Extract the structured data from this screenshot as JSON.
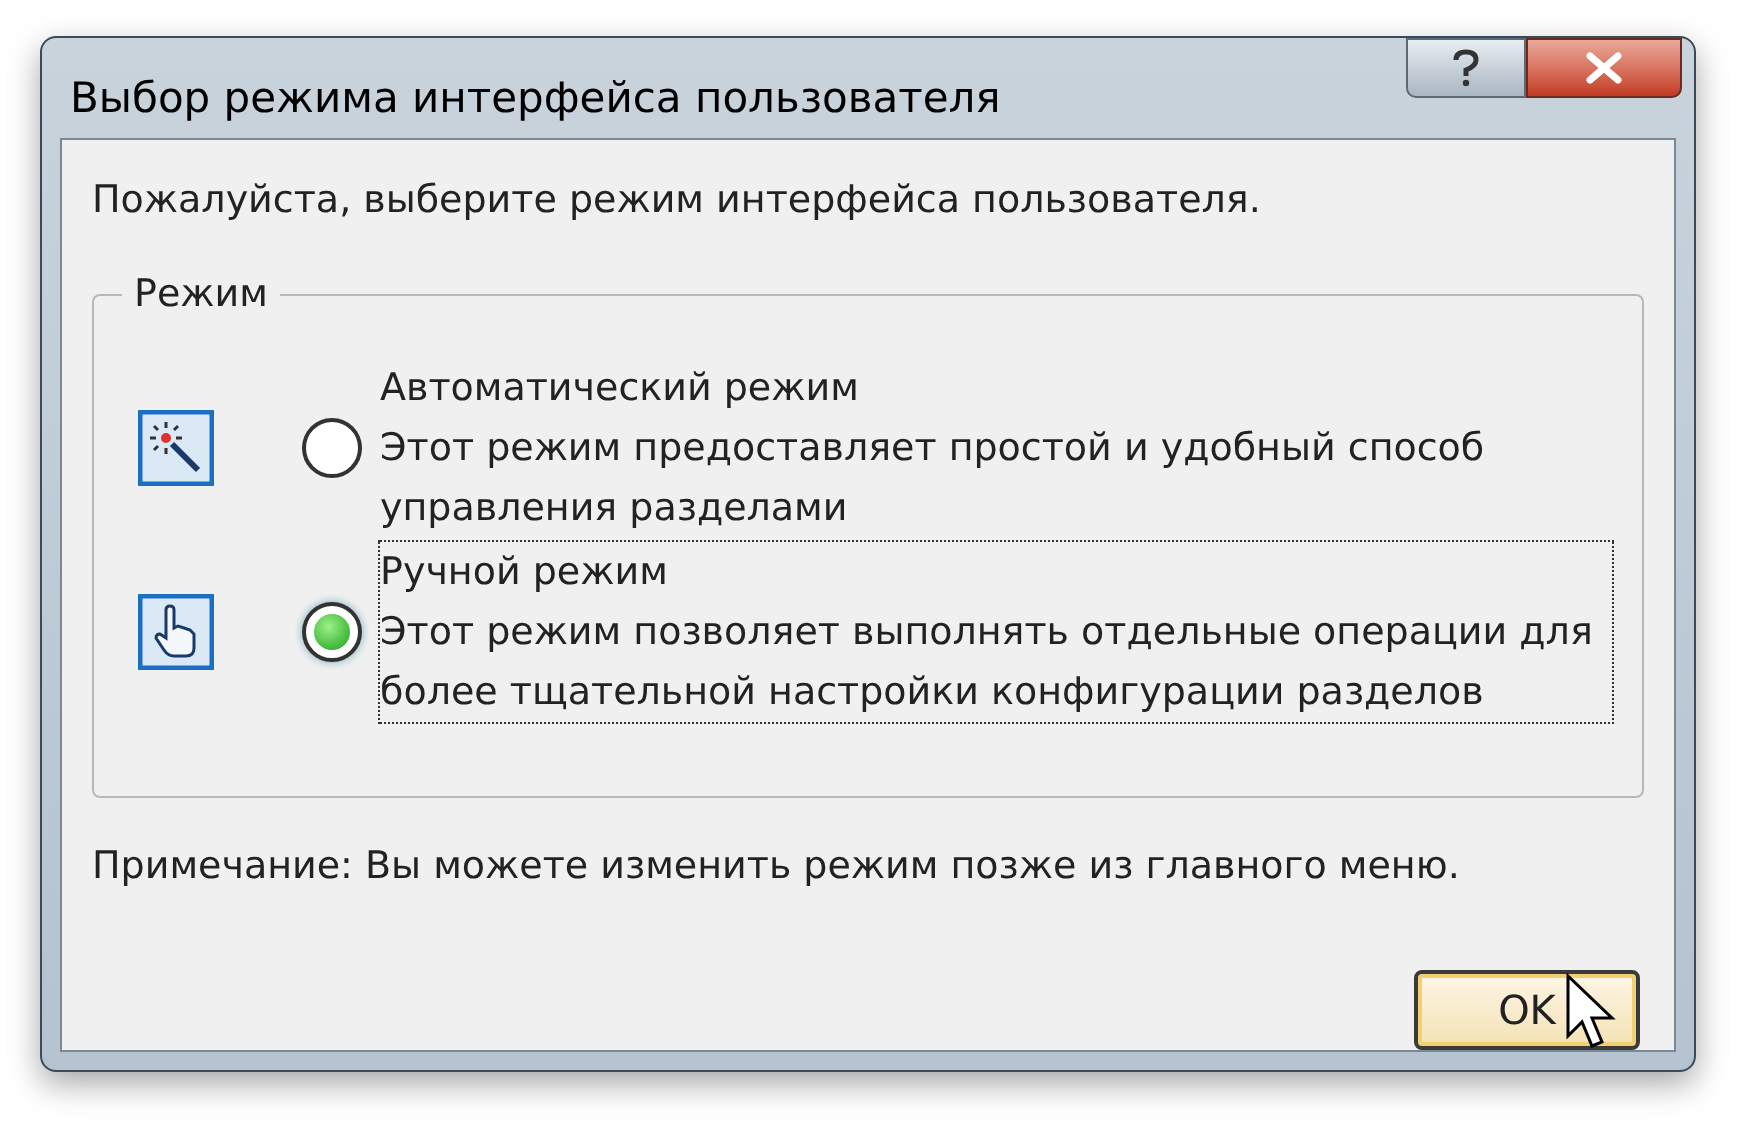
{
  "window": {
    "title": "Выбор режима интерфейса пользователя"
  },
  "prompt": "Пожалуйста, выберите режим интерфейса пользователя.",
  "group": {
    "legend": "Режим",
    "options": [
      {
        "kind": "wand",
        "title": "Автоматический режим",
        "description": "Этот режим предоставляет простой и удобный способ управления разделами",
        "selected": false
      },
      {
        "kind": "hand",
        "title": "Ручной режим",
        "description": "Этот режим позволяет выполнять отдельные операции для более тщательной настройки конфигурации разделов",
        "selected": true
      }
    ]
  },
  "note": "Примечание: Вы можете изменить режим позже из главного меню.",
  "buttons": [
    {
      "label": "OK"
    }
  ]
}
